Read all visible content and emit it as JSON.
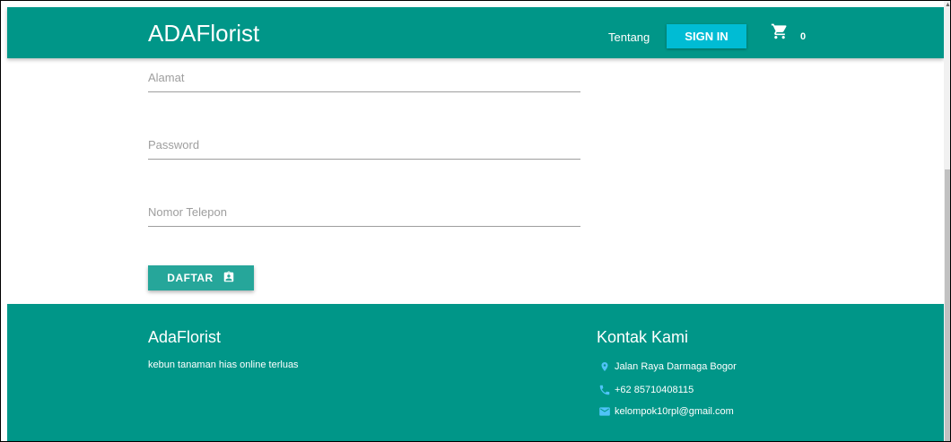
{
  "navbar": {
    "brand": "ADAFlorist",
    "link_about": "Tentang",
    "signin_label": "SIGN IN",
    "cart_count": "0"
  },
  "form": {
    "address_placeholder": "Alamat",
    "password_placeholder": "Password",
    "phone_placeholder": "Nomor Telepon",
    "submit_label": "DAFTAR"
  },
  "footer": {
    "brand": "AdaFlorist",
    "tagline": "kebun tanaman hias online terluas",
    "contact_title": "Kontak Kami",
    "address": "Jalan Raya Darmaga Bogor",
    "phone": "+62 85710408115",
    "email": "kelompok10rpl@gmail.com"
  },
  "icons": {
    "cart": "shopping-cart-icon",
    "submit": "assignment-ind-icon",
    "address": "location-pin-icon",
    "phone": "phone-icon",
    "email": "mail-icon"
  },
  "colors": {
    "primary": "#009688",
    "accent": "#00bcd4",
    "button": "#26a69a",
    "contact_icon": "#4fc3f7"
  }
}
